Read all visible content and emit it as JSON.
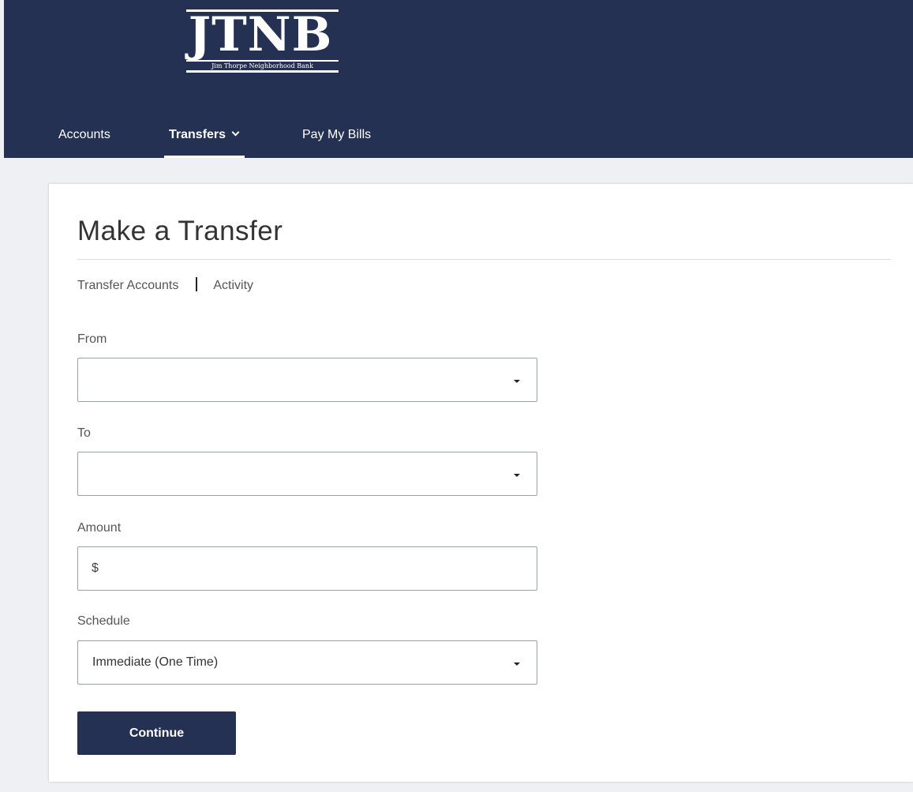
{
  "brand": {
    "logo_text": "JTNB",
    "tagline": "Jim Thorpe Neighborhood Bank"
  },
  "nav": {
    "items": [
      {
        "label": "Accounts",
        "active": false
      },
      {
        "label": "Transfers",
        "active": true,
        "has_dropdown": true
      },
      {
        "label": "Pay My Bills",
        "active": false
      }
    ]
  },
  "page": {
    "title": "Make a Transfer",
    "subnav": [
      "Transfer Accounts",
      "Activity"
    ]
  },
  "form": {
    "from": {
      "label": "From",
      "value": ""
    },
    "to": {
      "label": "To",
      "value": ""
    },
    "amount": {
      "label": "Amount",
      "prefix": "$",
      "value": ""
    },
    "schedule": {
      "label": "Schedule",
      "value": "Immediate (One Time)"
    },
    "continue_label": "Continue"
  },
  "colors": {
    "header_bg": "#253152",
    "page_bg": "#eef0f3",
    "button_bg": "#253152"
  }
}
